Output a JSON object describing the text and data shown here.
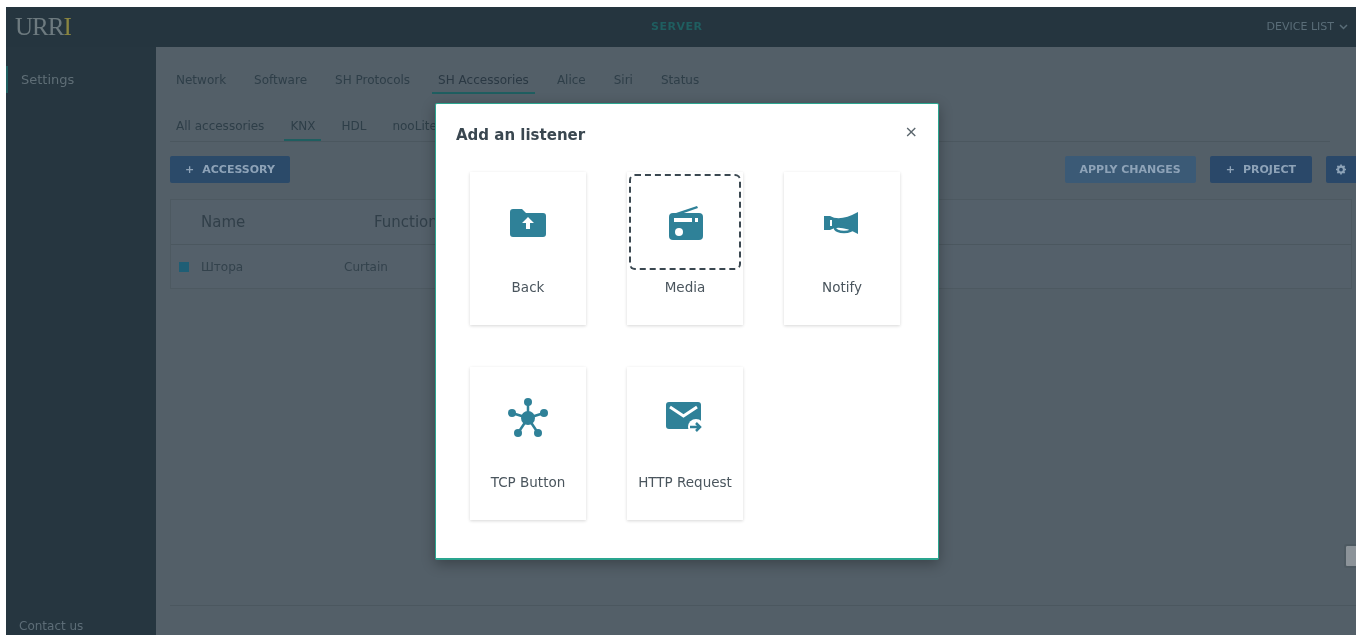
{
  "header": {
    "logo": {
      "text": "URR",
      "accent": "I"
    },
    "center": "SERVER",
    "menu": "DEVICE LIST"
  },
  "sidebar": {
    "items": [
      {
        "label": "Settings",
        "selected": true
      }
    ],
    "footer": "Contact us"
  },
  "tabs": [
    {
      "label": "Network",
      "selected": false
    },
    {
      "label": "Software",
      "selected": false
    },
    {
      "label": "SH Protocols",
      "selected": false
    },
    {
      "label": "SH Accessories",
      "selected": true
    },
    {
      "label": "Alice",
      "selected": false
    },
    {
      "label": "Siri",
      "selected": false
    },
    {
      "label": "Status",
      "selected": false
    }
  ],
  "subtabs": [
    {
      "label": "All accessories",
      "selected": false
    },
    {
      "label": "KNX",
      "selected": true
    },
    {
      "label": "HDL",
      "selected": false
    },
    {
      "label": "nooLite",
      "selected": false
    }
  ],
  "toolbar": {
    "add_icon": "+",
    "add": "ACCESSORY",
    "project_icon": "+",
    "apply": "APPLY CHANGES",
    "project": "PROJECT"
  },
  "table": {
    "columns": [
      "Name",
      "Function"
    ],
    "rows": [
      {
        "name": "Штора",
        "function": "Curtain"
      }
    ]
  },
  "dialog": {
    "title": "Add an listener",
    "close": "×",
    "options": [
      {
        "label": "Back",
        "kind": "folder",
        "selected": false
      },
      {
        "label": "Media",
        "kind": "radio",
        "selected": true
      },
      {
        "label": "Notify",
        "kind": "horn",
        "selected": false
      },
      {
        "label": "TCP Button",
        "kind": "hub",
        "selected": false
      },
      {
        "label": "HTTP Request",
        "kind": "mail",
        "selected": false
      }
    ]
  }
}
